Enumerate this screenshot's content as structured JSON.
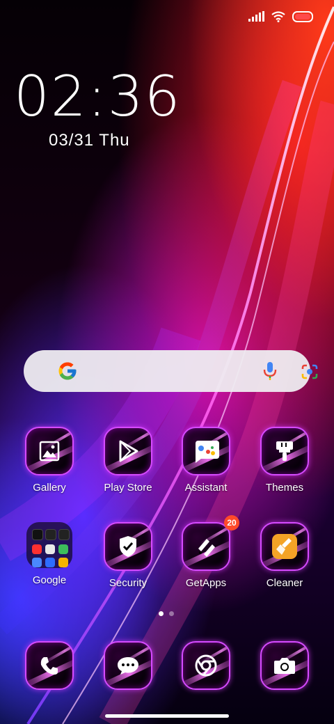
{
  "status_bar": {
    "signal_icon": "signal-icon",
    "wifi_icon": "wifi-icon",
    "battery_icon": "battery-icon",
    "battery_color": "#ff4a4a"
  },
  "clock": {
    "time": "02:36",
    "date": "03/31 Thu"
  },
  "search_bar": {
    "logo_icon": "google-g-icon",
    "mic_icon": "microphone-icon",
    "lens_icon": "google-lens-icon"
  },
  "apps_row1": [
    {
      "label": "Gallery",
      "icon": "gallery-icon"
    },
    {
      "label": "Play Store",
      "icon": "play-store-icon"
    },
    {
      "label": "Assistant",
      "icon": "assistant-icon"
    },
    {
      "label": "Themes",
      "icon": "themes-brush-icon"
    }
  ],
  "apps_row2": [
    {
      "label": "Google",
      "icon": "google-folder"
    },
    {
      "label": "Security",
      "icon": "shield-check-icon"
    },
    {
      "label": "GetApps",
      "icon": "getapps-icon",
      "badge": "20"
    },
    {
      "label": "Cleaner",
      "icon": "cleaner-broom-icon"
    }
  ],
  "dock": [
    {
      "name": "Phone",
      "icon": "phone-icon"
    },
    {
      "name": "Messages",
      "icon": "message-icon"
    },
    {
      "name": "Chrome",
      "icon": "chrome-icon"
    },
    {
      "name": "Camera",
      "icon": "camera-icon"
    }
  ],
  "page_indicator": {
    "pages": 2,
    "current": 1
  },
  "accent_color": "#d64bff"
}
